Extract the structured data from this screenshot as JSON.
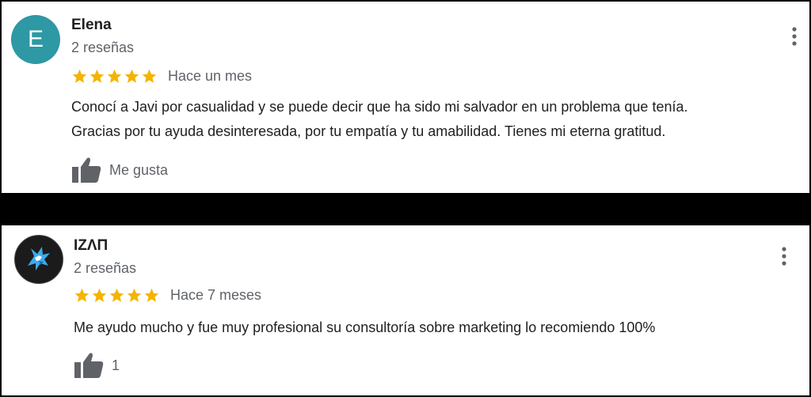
{
  "reviews": [
    {
      "avatar_letter": "E",
      "avatar_color": "#2e98a5",
      "name": "Elena",
      "review_count": "2 reseñas",
      "rating": 5,
      "date": "Hace un mes",
      "text_line1": "Conocí a Javi por casualidad y se puede decir que ha sido mi salvador en un problema que tenía.",
      "text_line2": "Gracias por tu ayuda desinteresada, por tu empatía y tu amabilidad. Tienes mi eterna gratitud.",
      "like_label": "Me gusta",
      "like_icon": "thumbs-up-icon",
      "menu_icon": "more-vert-icon"
    },
    {
      "avatar_icon": "wolf-logo-icon",
      "name": "IZΛΠ",
      "review_count": "2 reseñas",
      "rating": 5,
      "date": "Hace 7 meses",
      "text_line1": "Me ayudo mucho y fue muy profesional su consultoría sobre marketing lo recomiendo 100%",
      "like_label": "1",
      "like_icon": "thumbs-up-icon",
      "menu_icon": "more-vert-icon"
    }
  ],
  "colors": {
    "star": "#f4b400",
    "secondary_text": "#5f6368",
    "primary_text": "#1f1f1f",
    "icon_gray": "#5f6368",
    "separator": "#000000"
  }
}
